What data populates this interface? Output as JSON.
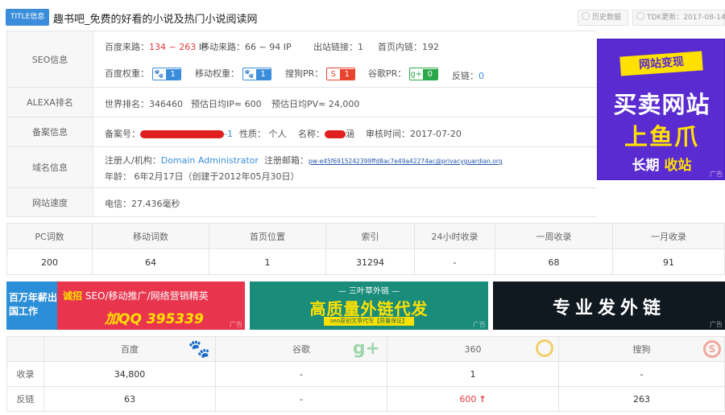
{
  "header": {
    "badge": "TITLE信息",
    "title": "趣书吧_免费的好看的小说及热门小说阅读网",
    "history_btn": "历史数据",
    "tdk_btn": "TDK更新：2017-08-14"
  },
  "seo": {
    "label": "SEO信息",
    "baidu_source_label": "百度来路：",
    "baidu_source_value": "134 ~ 263",
    "baidu_source_unit": "IP",
    "mobile_source_label": "移动来路：",
    "mobile_source_value": "66 ~ 94 IP",
    "outlinks_label": "出站链接：",
    "outlinks_value": "1",
    "home_inlinks_label": "首页内链：",
    "home_inlinks_value": "192",
    "baidu_weight_label": "百度权重：",
    "baidu_weight_value": "1",
    "mobile_weight_label": "移动权重：",
    "mobile_weight_value": "1",
    "sogou_pr_label": "搜狗PR：",
    "sogou_pr_value": "1",
    "google_pr_label": "谷歌PR：",
    "google_pr_value": "0",
    "backlinks_label": "反链：",
    "backlinks_value": "0"
  },
  "alexa": {
    "label": "ALEXA排名",
    "world_rank_label": "世界排名：",
    "world_rank_value": "346460",
    "daily_ip": "预估日均IP≈ 600",
    "daily_pv": "预估日均PV≈ 24,000"
  },
  "icp": {
    "label": "备案信息",
    "number_label": "备案号：",
    "number_suffix": "-1",
    "nature": "性质： 个人",
    "name_label": "名称：",
    "name_suffix": "涵",
    "review_time": "审核时间：2017-07-20"
  },
  "domain": {
    "label": "域名信息",
    "registrant_label": "注册人/机构：",
    "registrant_value": "Domain Administrator",
    "email_label": "注册邮箱：",
    "email_value": "pw-e45f6915242399ffd8ac7e49a42274ac@privacyguardian.org",
    "age_text": "年龄： 6年2月17日（创建于2012年05月30日）"
  },
  "speed": {
    "label": "网站速度",
    "value": "电信：27.436毫秒"
  },
  "side_ad": {
    "tag": "网站变现",
    "line1": "买卖网站",
    "line2": "上鱼爪",
    "line3a": "长期",
    "line3b": "收站",
    "ad_label": "广告"
  },
  "stats": {
    "headers": [
      "PC词数",
      "移动词数",
      "首页位置",
      "索引",
      "24小时收录",
      "一周收录",
      "一月收录"
    ],
    "values": [
      "200",
      "64",
      "1",
      "31294",
      "-",
      "68",
      "91"
    ]
  },
  "banners": {
    "b1_left": "百万年薪出国工作",
    "b1_line_a": "诚招",
    "b1_line_b": "SEO/移动推广/网络营销精英",
    "b1_qq": "加QQ 395339",
    "b2_top": "— 三叶草外链 —",
    "b2_main": "高质量外链代发",
    "b2_sub": "seo原创文章代写【质量保证】",
    "b3_main": "专业发外链",
    "ad_label": "广告"
  },
  "engines": {
    "headers": [
      "百度",
      "谷歌",
      "360",
      "搜狗"
    ],
    "rows": [
      {
        "label": "收录",
        "values": [
          "34,800",
          "-",
          "1",
          "-"
        ]
      },
      {
        "label": "反链",
        "values": [
          "63",
          "-",
          "600",
          "263"
        ]
      }
    ]
  },
  "colors": {
    "accent": "#3b8ddb",
    "red": "#e4393c",
    "sogou_red": "#e8432e",
    "google_green": "#2aa84a"
  }
}
